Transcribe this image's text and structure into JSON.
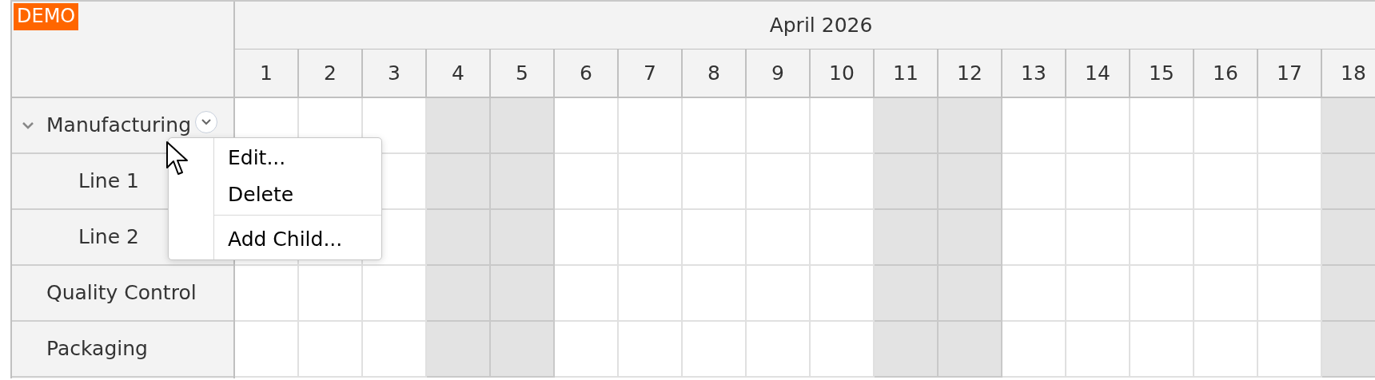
{
  "badge": "DEMO",
  "header": {
    "month": "April 2026"
  },
  "days": [
    {
      "label": "1",
      "weekend": false
    },
    {
      "label": "2",
      "weekend": false
    },
    {
      "label": "3",
      "weekend": false
    },
    {
      "label": "4",
      "weekend": true
    },
    {
      "label": "5",
      "weekend": true
    },
    {
      "label": "6",
      "weekend": false
    },
    {
      "label": "7",
      "weekend": false
    },
    {
      "label": "8",
      "weekend": false
    },
    {
      "label": "9",
      "weekend": false
    },
    {
      "label": "10",
      "weekend": false
    },
    {
      "label": "11",
      "weekend": true
    },
    {
      "label": "12",
      "weekend": true
    },
    {
      "label": "13",
      "weekend": false
    },
    {
      "label": "14",
      "weekend": false
    },
    {
      "label": "15",
      "weekend": false
    },
    {
      "label": "16",
      "weekend": false
    },
    {
      "label": "17",
      "weekend": false
    },
    {
      "label": "18",
      "weekend": true
    }
  ],
  "resources": [
    {
      "name": "Manufacturing",
      "expanded": true,
      "children": [
        {
          "name": "Line 1"
        },
        {
          "name": "Line 2"
        }
      ]
    },
    {
      "name": "Quality Control"
    },
    {
      "name": "Packaging"
    }
  ],
  "context_menu": {
    "items": [
      {
        "label": "Edit...",
        "separator_before": false
      },
      {
        "label": "Delete",
        "separator_before": false
      },
      {
        "label": "Add Child...",
        "separator_before": true
      }
    ]
  }
}
